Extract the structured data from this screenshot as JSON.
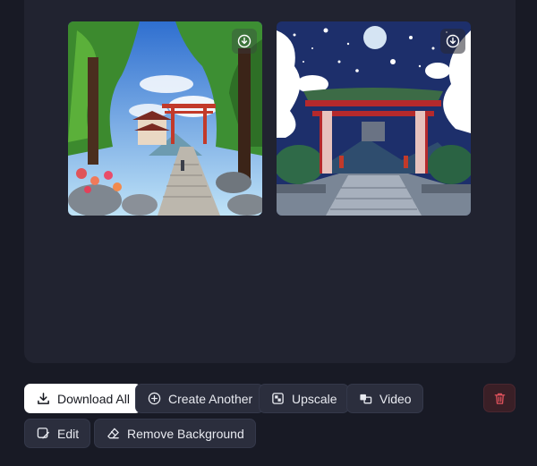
{
  "images": [
    {
      "name": "Forest shrine path with red torii gate",
      "download_icon": "download-circle-icon"
    },
    {
      "name": "Night torii gate with full moon",
      "download_icon": "download-circle-icon"
    }
  ],
  "actions": {
    "download_all": "Download All",
    "create_another": "Create Another",
    "upscale": "Upscale",
    "video": "Video",
    "edit": "Edit",
    "remove_background": "Remove Background"
  },
  "colors": {
    "background": "#181a25",
    "panel": "#212330",
    "button": "#2b2e3d",
    "primary_button": "#ffffff",
    "delete": "#e0525c"
  }
}
